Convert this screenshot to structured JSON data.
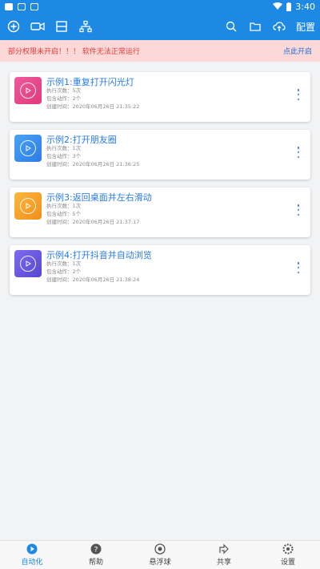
{
  "status_bar": {
    "time": "3:40"
  },
  "toolbar": {
    "config_label": "配置"
  },
  "warning": {
    "message": "部分权限未开启！！！ 软件无法正常运行",
    "action": "点此开启"
  },
  "cards": [
    {
      "title": "示例1:重复打开闪光灯",
      "runs": "执行次数：5次",
      "actions": "包含动作：2个",
      "created": "创建时间：2020年06月26日 21:35:22",
      "color": "#e84a8f"
    },
    {
      "title": "示例2:打开朋友圈",
      "runs": "执行次数：1次",
      "actions": "包含动作：3个",
      "created": "创建时间：2020年06月26日 21:36:25",
      "color": "#3b8ff0"
    },
    {
      "title": "示例3:返回桌面并左右滑动",
      "runs": "执行次数：1次",
      "actions": "包含动作：5个",
      "created": "创建时间：2020年06月26日 21:37:17",
      "color": "#f6a228"
    },
    {
      "title": "示例4:打开抖音并自动浏览",
      "runs": "执行次数：1次",
      "actions": "包含动作：2个",
      "created": "创建时间：2020年06月26日 21:38:24",
      "color": "#6a5ce0"
    }
  ],
  "bottom_nav": [
    {
      "label": "自动化",
      "icon": "play-circle-icon",
      "active": true
    },
    {
      "label": "帮助",
      "icon": "help-icon"
    },
    {
      "label": "悬浮球",
      "icon": "float-ball-icon"
    },
    {
      "label": "共享",
      "icon": "share-icon"
    },
    {
      "label": "设置",
      "icon": "settings-icon"
    }
  ],
  "colors": {
    "primary": "#1e88e5",
    "warning_bg": "#fcd8d8",
    "warning_text": "#e53935"
  }
}
